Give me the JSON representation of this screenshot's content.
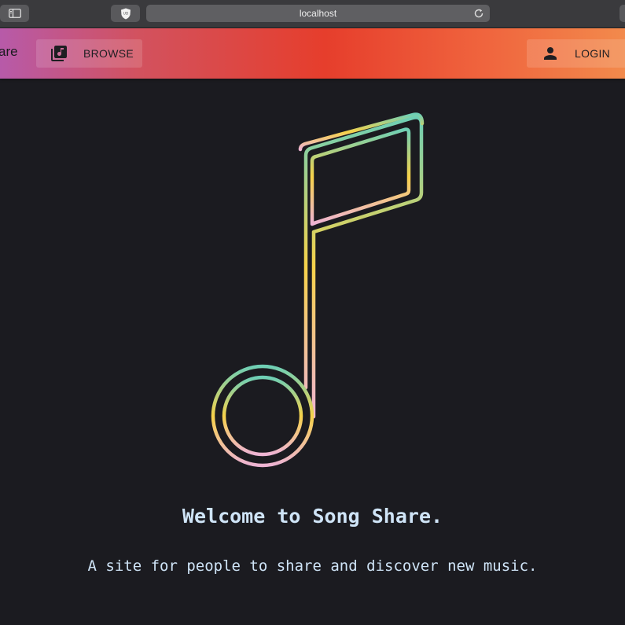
{
  "browser": {
    "url": "localhost",
    "extension_badge": "UD"
  },
  "header": {
    "brand_fragment": "are",
    "browse_label": "BROWSE",
    "login_label": "LOGIN",
    "gradient_colors": [
      "#b75aa9",
      "#d2525f",
      "#e63e2c",
      "#f0653e",
      "#f28a4c"
    ]
  },
  "hero": {
    "title": "Welcome to Song Share.",
    "subtitle": "A site for people to share and discover new music.",
    "note_gradient": [
      "#6ecfb5",
      "#f6d24a",
      "#eeb4d4"
    ]
  },
  "icons": {
    "sidebar": "sidebar-icon",
    "extension": "shield-icon",
    "reload": "reload-icon",
    "browse": "library-music-icon",
    "login": "person-icon",
    "hero": "music-note-icon"
  }
}
